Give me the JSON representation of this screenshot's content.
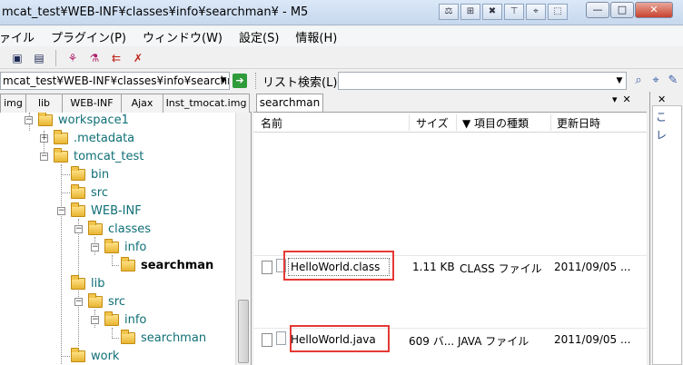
{
  "window": {
    "title": "mcat_test¥WEB-INF¥classes¥info¥searchman¥ - M5",
    "title_icons": [
      "⚖",
      "⊞",
      "✖",
      "⊤",
      "⌖",
      "⬚"
    ],
    "controls": {
      "minimize": "—",
      "maximize": "□",
      "close": "✕"
    }
  },
  "menu": {
    "items": [
      "ファイル",
      "プラグイン(P)",
      "ウィンドウ(W)",
      "設定(S)",
      "情報(H)"
    ]
  },
  "toolbar": {
    "icons": [
      "▣",
      "▤",
      "⚘",
      "⚗",
      "⇇",
      "✗"
    ]
  },
  "address": {
    "path": "mcat_test¥WEB-INF¥classes¥info¥searchman¥",
    "dropdown": "▼",
    "go_icon": "➔"
  },
  "search": {
    "label": "リスト検索(L)",
    "value": "",
    "dropdown": "▼",
    "icons": [
      "⌕",
      "⌖",
      "✎"
    ]
  },
  "left_tabs": [
    "img",
    "lib",
    "WEB-INF",
    "Ajax",
    "Inst_tmocat.img"
  ],
  "tree": [
    {
      "label": "workspace1",
      "expander": "−"
    },
    {
      "label": ".metadata",
      "expander": "+"
    },
    {
      "label": "tomcat_test",
      "expander": "−"
    },
    {
      "label": "bin",
      "expander": ""
    },
    {
      "label": "src",
      "expander": ""
    },
    {
      "label": "WEB-INF",
      "expander": "−"
    },
    {
      "label": "classes",
      "expander": "−"
    },
    {
      "label": "info",
      "expander": "−"
    },
    {
      "label": "searchman",
      "expander": "",
      "selected": true
    },
    {
      "label": "lib",
      "expander": ""
    },
    {
      "label": "src",
      "expander": "−"
    },
    {
      "label": "info",
      "expander": "−"
    },
    {
      "label": "searchman",
      "expander": ""
    },
    {
      "label": "work",
      "expander": ""
    }
  ],
  "right_tab": {
    "label": "searchman",
    "dropdown": "▾",
    "close": "✕"
  },
  "columns": {
    "name": "名前",
    "size": "サイズ",
    "type": "▼ 項目の種類",
    "date": "更新日時"
  },
  "files": [
    {
      "name": "HelloWorld.class",
      "size": "1.11 KB",
      "type": "CLASS ファイル",
      "date": "2011/09/05 ..."
    },
    {
      "name": "HelloWorld.java",
      "size": "609 バ...",
      "type": "JAVA ファイル",
      "date": "2011/09/05 ..."
    }
  ],
  "far_right": {
    "close": "✕",
    "items": [
      "こ",
      "レ"
    ]
  },
  "colors": {
    "tree_label": "#0f6f76",
    "highlight_box": "#e53935",
    "folder": "#e8b531"
  }
}
